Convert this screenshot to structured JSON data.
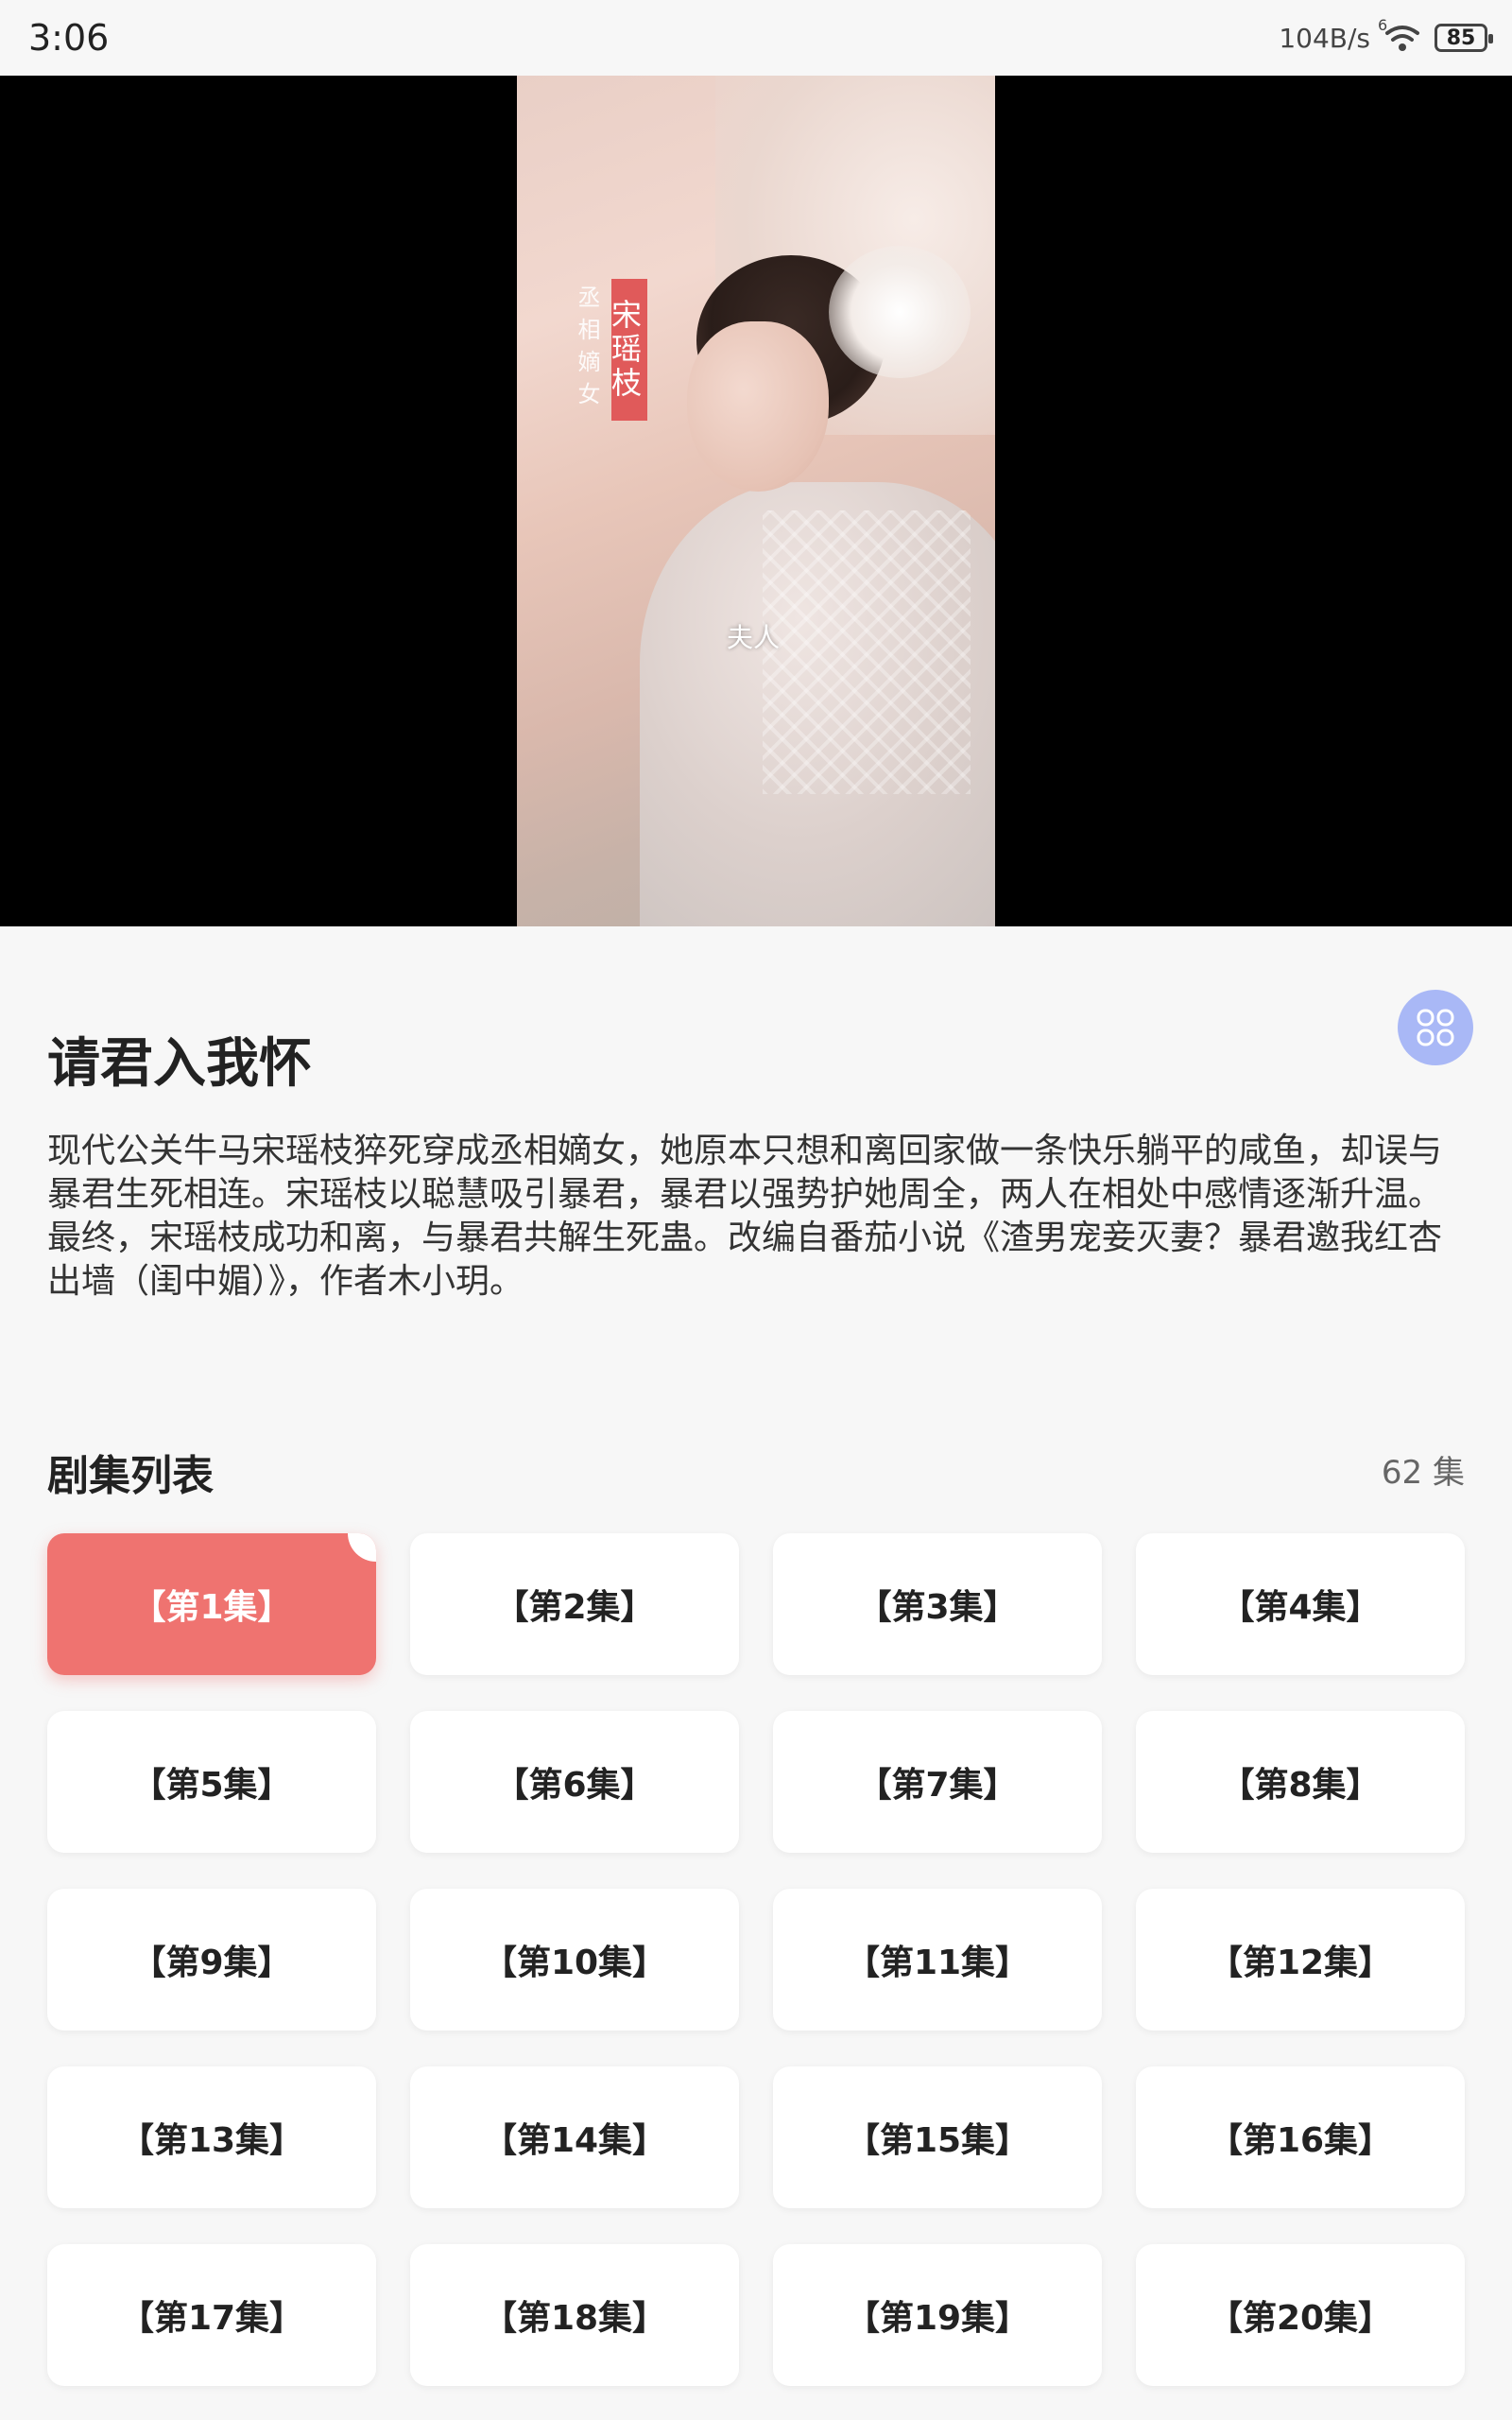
{
  "status": {
    "time": "3:06",
    "network": "104B/s",
    "signal": "6",
    "battery": "85"
  },
  "video": {
    "name_caption": "宋瑶枝",
    "role_caption": "丞相嫡女",
    "subtitle": "夫人"
  },
  "drama": {
    "title": "请君入我怀",
    "description": "现代公关牛马宋瑶枝猝死穿成丞相嫡女，她原本只想和离回家做一条快乐躺平的咸鱼，却误与暴君生死相连。宋瑶枝以聪慧吸引暴君，暴君以强势护她周全，两人在相处中感情逐渐升温。最终，宋瑶枝成功和离，与暴君共解生死蛊。改编自番茄小说《渣男宠妾灭妻？暴君邀我红杏出墙（闺中媚）》，作者木小玥。"
  },
  "episodes": {
    "section_title": "剧集列表",
    "count": "62 集",
    "items": [
      "【第1集】",
      "【第2集】",
      "【第3集】",
      "【第4集】",
      "【第5集】",
      "【第6集】",
      "【第7集】",
      "【第8集】",
      "【第9集】",
      "【第10集】",
      "【第11集】",
      "【第12集】",
      "【第13集】",
      "【第14集】",
      "【第15集】",
      "【第16集】",
      "【第17集】",
      "【第18集】",
      "【第19集】",
      "【第20集】"
    ]
  },
  "colors": {
    "accent": "#ef7370",
    "grid_button": "#a9b8f6"
  },
  "icons": {
    "grid_button": "grid-icon",
    "wifi": "wifi-icon"
  }
}
